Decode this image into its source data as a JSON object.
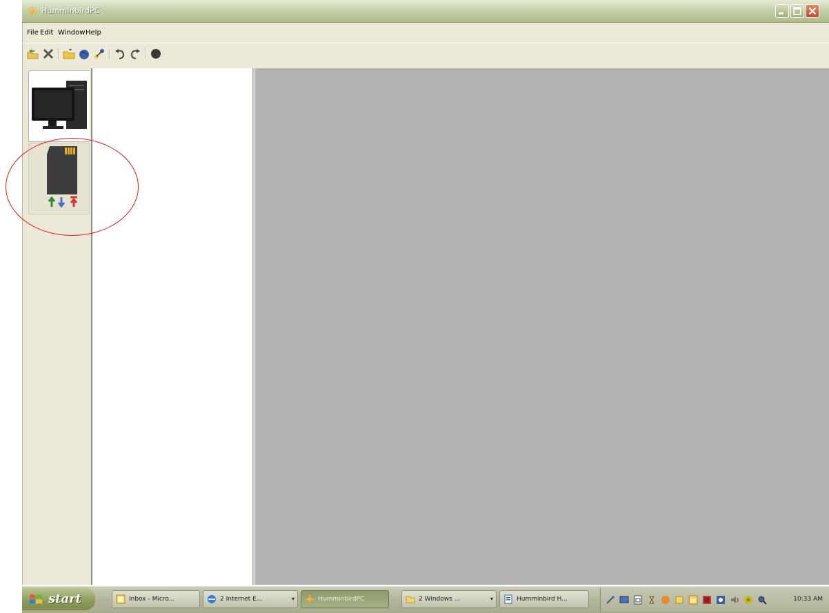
{
  "window": {
    "title": "HumminbirdPC"
  },
  "menu": {
    "items": [
      {
        "label": "File"
      },
      {
        "label": "Edit"
      },
      {
        "label": "Window"
      },
      {
        "label": "Help"
      }
    ]
  },
  "toolbar": {
    "buttons": [
      {
        "icon": "open-folder-icon"
      },
      {
        "icon": "delete-x-icon"
      },
      {
        "icon": "folder-open-icon"
      },
      {
        "icon": "globe-icon"
      },
      {
        "icon": "route-icon"
      },
      {
        "icon": "undo-icon"
      },
      {
        "icon": "redo-icon"
      },
      {
        "icon": "record-stop-icon"
      }
    ]
  },
  "tabs": [
    {
      "icon": "computer-monitor-icon",
      "selected": true
    },
    {
      "icon": "sd-card-transfer-icon",
      "selected": false
    }
  ],
  "taskbar": {
    "start_label": "start",
    "buttons": [
      {
        "label": "Inbox - Micro...",
        "icon": "outlook-icon"
      },
      {
        "label": "2 Internet E...",
        "icon": "internet-explorer-icon"
      },
      {
        "label": "HumminbirdPC",
        "icon": "humminbird-icon",
        "active": true
      },
      {
        "label": "2 Windows ...",
        "icon": "folder-icon"
      },
      {
        "label": "Humminbird H...",
        "icon": "document-icon"
      }
    ],
    "clock": "10:33 AM"
  },
  "colors": {
    "title_bar": "#c6d1ab",
    "workspace": "#b3b3b3",
    "annotation": "#e21b1b",
    "start_button": "#8a9b5b"
  }
}
